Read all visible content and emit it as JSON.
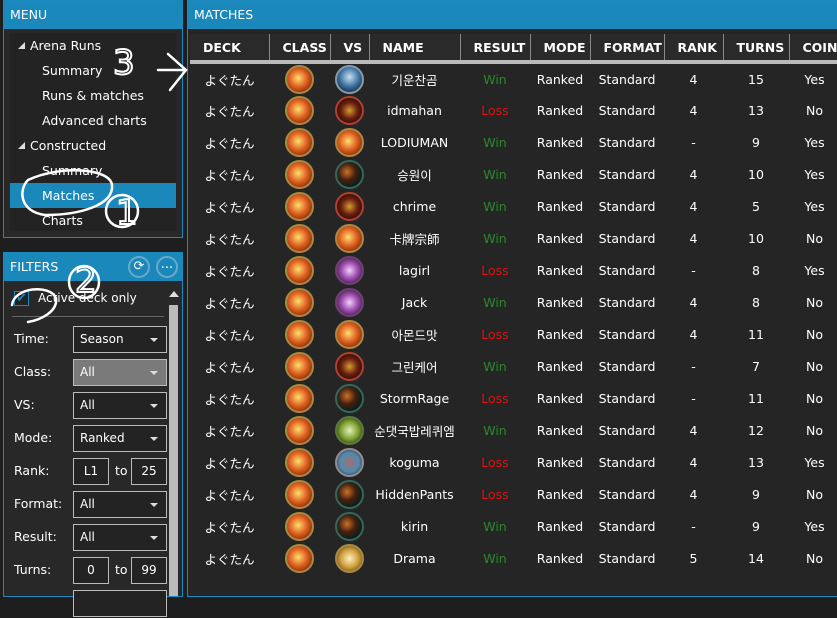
{
  "menu": {
    "title": "MENU",
    "groups": [
      {
        "label": "Arena Runs",
        "items": [
          "Summary",
          "Runs & matches",
          "Advanced charts"
        ]
      },
      {
        "label": "Constructed",
        "items": [
          "Summary",
          "Matches",
          "Charts"
        ]
      }
    ],
    "selected": "Matches"
  },
  "filters": {
    "title": "FILTERS",
    "refresh_icon": "refresh-icon",
    "more_label": "...",
    "active_deck_label": "Active deck only",
    "active_deck_checked": true,
    "time": {
      "label": "Time:",
      "value": "Season"
    },
    "class": {
      "label": "Class:",
      "value": "All"
    },
    "vs": {
      "label": "VS:",
      "value": "All"
    },
    "mode": {
      "label": "Mode:",
      "value": "Ranked"
    },
    "rank": {
      "label": "Rank:",
      "from": "L1",
      "to_label": "to",
      "to": "25"
    },
    "format": {
      "label": "Format:",
      "value": "All"
    },
    "result": {
      "label": "Result:",
      "value": "All"
    },
    "turns": {
      "label": "Turns:",
      "from": "0",
      "to_label": "to",
      "to": "99"
    }
  },
  "matches": {
    "title": "MATCHES",
    "columns": [
      "DECK",
      "CLASS",
      "VS",
      "NAME",
      "RESULT",
      "MODE",
      "FORMAT",
      "RANK",
      "TURNS",
      "COIN"
    ],
    "rows": [
      {
        "deck": "よぐたん",
        "class": "mage",
        "vs": "rogue",
        "name": "기운찬곰",
        "result": "Win",
        "mode": "Ranked",
        "format": "Standard",
        "rank": "4",
        "turns": "15",
        "coin": "Yes"
      },
      {
        "deck": "よぐたん",
        "class": "mage",
        "vs": "warrior",
        "name": "idmahan",
        "result": "Loss",
        "mode": "Ranked",
        "format": "Standard",
        "rank": "4",
        "turns": "13",
        "coin": "No"
      },
      {
        "deck": "よぐたん",
        "class": "mage",
        "vs": "mage",
        "name": "LODIUMAN",
        "result": "Win",
        "mode": "Ranked",
        "format": "Standard",
        "rank": "-",
        "turns": "9",
        "coin": "Yes"
      },
      {
        "deck": "よぐたん",
        "class": "mage",
        "vs": "hunter",
        "name": "승원이",
        "result": "Win",
        "mode": "Ranked",
        "format": "Standard",
        "rank": "4",
        "turns": "10",
        "coin": "Yes"
      },
      {
        "deck": "よぐたん",
        "class": "mage",
        "vs": "warrior",
        "name": "chrime",
        "result": "Win",
        "mode": "Ranked",
        "format": "Standard",
        "rank": "4",
        "turns": "5",
        "coin": "Yes"
      },
      {
        "deck": "よぐたん",
        "class": "mage",
        "vs": "mage",
        "name": "卡牌宗師",
        "result": "Win",
        "mode": "Ranked",
        "format": "Standard",
        "rank": "4",
        "turns": "10",
        "coin": "No"
      },
      {
        "deck": "よぐたん",
        "class": "mage",
        "vs": "warlock",
        "name": "lagirl",
        "result": "Loss",
        "mode": "Ranked",
        "format": "Standard",
        "rank": "-",
        "turns": "8",
        "coin": "Yes"
      },
      {
        "deck": "よぐたん",
        "class": "mage",
        "vs": "warlock",
        "name": "Jack",
        "result": "Win",
        "mode": "Ranked",
        "format": "Standard",
        "rank": "4",
        "turns": "8",
        "coin": "No"
      },
      {
        "deck": "よぐたん",
        "class": "mage",
        "vs": "mage",
        "name": "아몬드맛",
        "result": "Loss",
        "mode": "Ranked",
        "format": "Standard",
        "rank": "4",
        "turns": "11",
        "coin": "No"
      },
      {
        "deck": "よぐたん",
        "class": "mage",
        "vs": "warrior",
        "name": "그린케어",
        "result": "Win",
        "mode": "Ranked",
        "format": "Standard",
        "rank": "-",
        "turns": "7",
        "coin": "No"
      },
      {
        "deck": "よぐたん",
        "class": "mage",
        "vs": "hunter",
        "name": "StormRage",
        "result": "Loss",
        "mode": "Ranked",
        "format": "Standard",
        "rank": "-",
        "turns": "11",
        "coin": "No"
      },
      {
        "deck": "よぐたん",
        "class": "mage",
        "vs": "druid",
        "name": "순댓국밥레퀴엠",
        "result": "Win",
        "mode": "Ranked",
        "format": "Standard",
        "rank": "4",
        "turns": "12",
        "coin": "No"
      },
      {
        "deck": "よぐたん",
        "class": "mage",
        "vs": "shaman",
        "name": "koguma",
        "result": "Loss",
        "mode": "Ranked",
        "format": "Standard",
        "rank": "4",
        "turns": "13",
        "coin": "Yes"
      },
      {
        "deck": "よぐたん",
        "class": "mage",
        "vs": "hunter",
        "name": "HiddenPants",
        "result": "Loss",
        "mode": "Ranked",
        "format": "Standard",
        "rank": "4",
        "turns": "9",
        "coin": "No"
      },
      {
        "deck": "よぐたん",
        "class": "mage",
        "vs": "hunter",
        "name": "kirin",
        "result": "Win",
        "mode": "Ranked",
        "format": "Standard",
        "rank": "-",
        "turns": "9",
        "coin": "Yes"
      },
      {
        "deck": "よぐたん",
        "class": "mage",
        "vs": "paladin",
        "name": "Drama",
        "result": "Win",
        "mode": "Ranked",
        "format": "Standard",
        "rank": "5",
        "turns": "14",
        "coin": "No"
      }
    ]
  },
  "colors": {
    "accent": "#1a88bb",
    "win": "#2a8a2a",
    "loss": "#e01010"
  },
  "annotations": {
    "labels": [
      "1",
      "2",
      "3"
    ]
  }
}
